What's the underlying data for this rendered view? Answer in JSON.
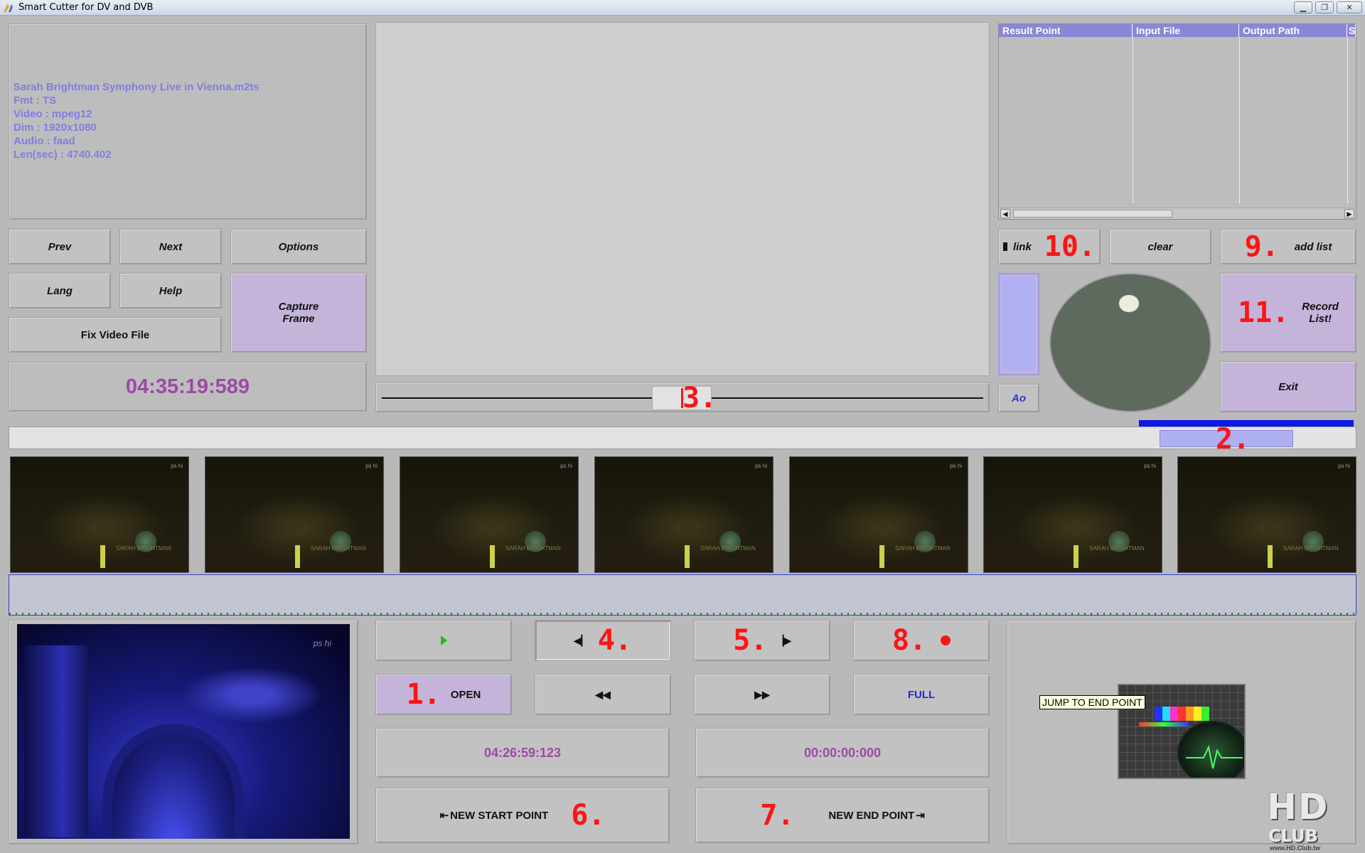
{
  "window": {
    "title": "Smart Cutter for DV and DVB",
    "minimize": "▁",
    "restore": "❐",
    "close": "✕"
  },
  "file_info": {
    "filename": "Sarah Brightman Symphony Live in Vienna.m2ts",
    "fmt": "Fmt : TS",
    "video": "Video : mpeg12",
    "dim": "Dim : 1920x1080",
    "audio": "Audio : faad",
    "length": "Len(sec) : 4740.402"
  },
  "left_buttons": {
    "prev": "Prev",
    "next": "Next",
    "options": "Options",
    "lang": "Lang",
    "help": "Help",
    "capture_frame_line1": "Capture",
    "capture_frame_line2": "Frame",
    "fix_video": "Fix Video File"
  },
  "current_time": "04:35:19:589",
  "markers": {
    "m1": "1.",
    "m2": "2.",
    "m3": "3.",
    "m4": "4.",
    "m5": "5.",
    "m6": "6.",
    "m7": "7.",
    "m8": "8.",
    "m9": "9.",
    "m10": "10.",
    "m11": "11."
  },
  "result_list": {
    "columns": [
      "Result Point",
      "Input File",
      "Output Path",
      "S"
    ],
    "rows": []
  },
  "right_buttons": {
    "link": "link",
    "clear": "clear",
    "add_list": "add list",
    "record_list_line1": "Record",
    "record_list_line2": "List!",
    "exit": "Exit",
    "ao": "Ao"
  },
  "thumbnails": [
    {
      "logo": "ps hi",
      "caption": "SARAH BRIGHTMAN"
    },
    {
      "logo": "ps hi",
      "caption": "SARAH BRIGHTMAN"
    },
    {
      "logo": "ps hi",
      "caption": "SARAH BRIGHTMAN"
    },
    {
      "logo": "ps hi",
      "caption": "SARAH BRIGHTMAN"
    },
    {
      "logo": "ps hi",
      "caption": "SARAH BRIGHTMAN"
    },
    {
      "logo": "ps hi",
      "caption": "SARAH BRIGHTMAN"
    },
    {
      "logo": "ps hi",
      "caption": "SARAH BRIGHTMAN"
    }
  ],
  "video_logo": "ps hi",
  "transport": {
    "open": "OPEN",
    "full": "FULL",
    "start_time": "04:26:59:123",
    "end_time": "00:00:00:000",
    "new_start": "NEW START POINT",
    "new_end": "NEW END POINT",
    "play_icon": "play-icon",
    "step_back_icon": "step-back-icon",
    "step_forward_icon": "step-forward-icon",
    "record_icon": "record-icon",
    "rewind_icon": "rewind-icon",
    "fast_forward_icon": "fast-forward-icon",
    "start_glyph": "⇤",
    "end_glyph": "⇥"
  },
  "tooltip": "JUMP TO END POINT",
  "club_logo": {
    "big": "HD",
    "sub": "CLUB",
    "url": "www.HD.Club.tw"
  },
  "colors": {
    "accent_purple": "#9c4aa6",
    "info_text": "#7f7fe2",
    "marker_red": "#ff1414",
    "progress_blue": "#0b18e6"
  }
}
